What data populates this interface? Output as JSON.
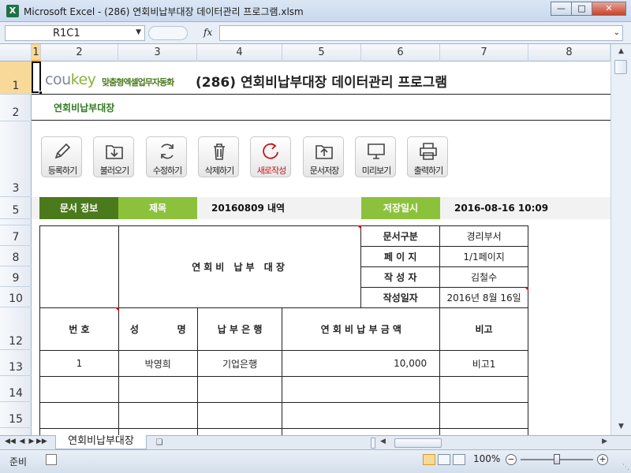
{
  "window": {
    "title": "Microsoft Excel - (286) 연회비납부대장 데이터관리 프로그램.xlsm",
    "app_icon": "X"
  },
  "formula_bar": {
    "name_box": "R1C1",
    "fx": "fx",
    "formula": ""
  },
  "columns": [
    "1",
    "2",
    "3",
    "4",
    "5",
    "6",
    "7",
    "8"
  ],
  "rows": [
    "1",
    "2",
    "3",
    "5",
    "7",
    "8",
    "9",
    "10",
    "12",
    "13",
    "14",
    "15"
  ],
  "header": {
    "logo_main": "cou",
    "logo_accent": "key",
    "logo_sub": "맞춤형엑셀업무자동화",
    "title": "(286) 연회비납부대장 데이터관리 프로그램",
    "sheet_label": "연회비납부대장"
  },
  "toolbar": {
    "register": "등록하기",
    "load": "불러오기",
    "edit": "수정하기",
    "delete": "삭제하기",
    "new": "새로작성",
    "save_doc": "문서저장",
    "preview": "미리보기",
    "print": "출력하기"
  },
  "info": {
    "doc_info": "문서 정보",
    "title_label": "제목",
    "title_value": "20160809 내역",
    "saved_label": "저장일시",
    "saved_value": "2016-08-16 10:09"
  },
  "document": {
    "big_title": "연회비 납부 대장",
    "meta": [
      {
        "label": "문서구분",
        "value": "경리부서"
      },
      {
        "label": "페 이 지",
        "value": "1/1페이지"
      },
      {
        "label": "작 성 자",
        "value": "김철수"
      },
      {
        "label": "작성일자",
        "value": "2016년 8월 16일"
      }
    ],
    "headers": {
      "no": "번 호",
      "name_1": "성",
      "name_2": "명",
      "bank": "납 부 은 행",
      "amount": "연 회 비 납 부 금 액",
      "note": "비고"
    },
    "rows": [
      {
        "no": "1",
        "name": "박영희",
        "bank": "기업은행",
        "amount": "10,000",
        "note": "비고1"
      }
    ]
  },
  "tabs": {
    "sheet": "연회비납부대장"
  },
  "status": {
    "ready": "준비",
    "zoom": "100%"
  }
}
